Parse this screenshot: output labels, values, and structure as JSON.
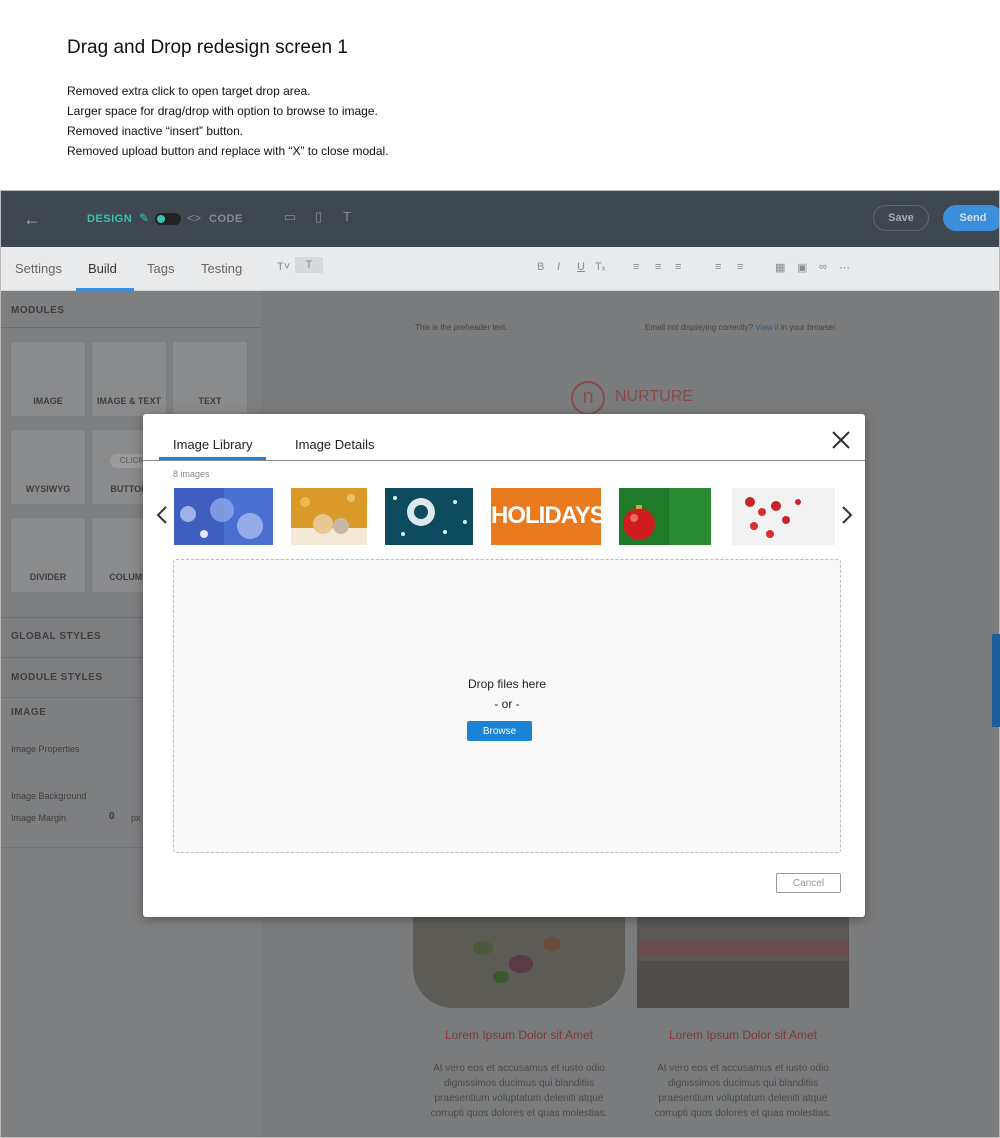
{
  "notes": {
    "title": "Drag and Drop redesign screen 1",
    "lines": [
      "Removed extra click to open target drop area.",
      "Larger space for drag/drop with option to browse to image.",
      "Removed inactive “insert” button.",
      "Removed upload button and replace with “X” to close modal."
    ]
  },
  "topbar": {
    "design_label": "DESIGN",
    "code_label": "CODE",
    "save_label": "Save",
    "send_label": "Send"
  },
  "tabs": [
    "Settings",
    "Build",
    "Tags",
    "Testing"
  ],
  "sidebar": {
    "modules_label": "MODULES",
    "tiles": [
      "IMAGE",
      "IMAGE & TEXT",
      "TEXT",
      "WYSIWYG",
      "BUTTON",
      "DIVIDER",
      "COLUMN"
    ],
    "global_styles_label": "GLOBAL STYLES",
    "module_styles_label": "MODULE STYLES",
    "image_label": "IMAGE",
    "image_properties_label": "Image Properties",
    "image_background_label": "Image Background",
    "image_margin_label": "Image Margin",
    "image_margin_value": "0",
    "image_margin_unit": "px",
    "button_badge": "CLICK"
  },
  "email": {
    "preheader": "This is the preheader text.",
    "view_text_1": "Email not displaying correctly?",
    "view_link": "View it",
    "view_text_2": "in your browser.",
    "logo_letter": "n",
    "brand": "NURTURE",
    "card_title_1": "Lorem Ipsum Dolor sit Amet",
    "card_title_2": "Lorem Ipsum Dolor sit Amet",
    "card_body_1": "At vero eos et accusamus et iusto odio dignissimos ducimus qui blanditiis praesentium voluptatum deleniti atque corrupti quos dolores et quas molestias.",
    "card_body_2": "At vero eos et accusamus et iusto odio dignissimos ducimus qui blanditiis praesentium voluptatum deleniti atque corrupti quos dolores et quas molestias."
  },
  "modal": {
    "tab_library": "Image Library",
    "tab_details": "Image Details",
    "image_count": "8 images",
    "holidays_text": "HOLIDAYS",
    "drop_text": "Drop files here",
    "or_text": "- or -",
    "browse_label": "Browse",
    "cancel_label": "Cancel",
    "accent_color": "#1a83d6"
  }
}
